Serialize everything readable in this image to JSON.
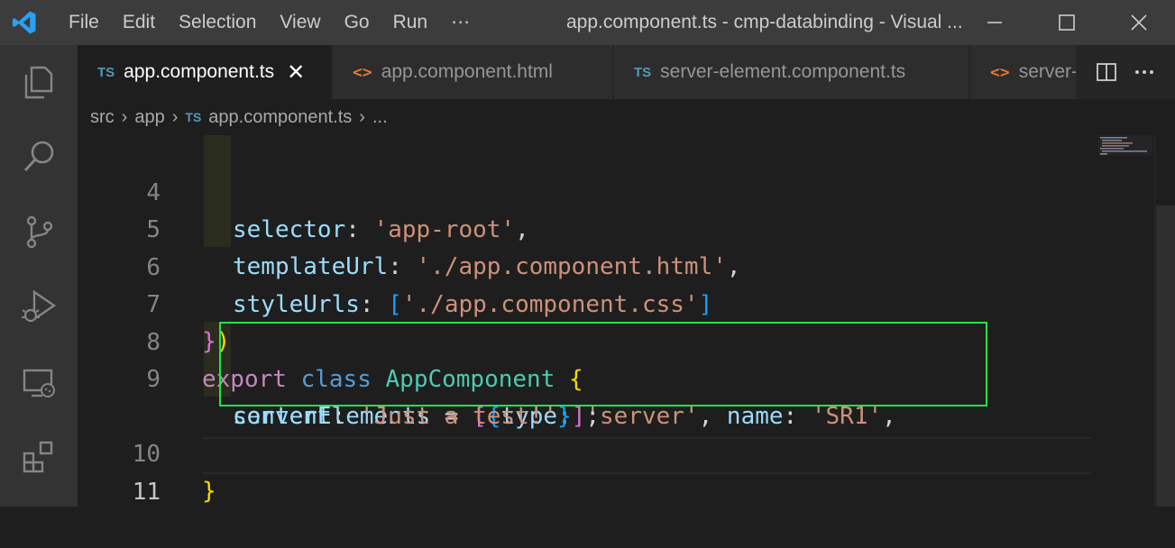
{
  "menu": [
    "File",
    "Edit",
    "Selection",
    "View",
    "Go",
    "Run",
    "⋯"
  ],
  "window_title": "app.component.ts - cmp-databinding - Visual ...",
  "tabs": [
    {
      "icon": "TS",
      "label": "app.component.ts",
      "close": "✕"
    },
    {
      "icon": "<>",
      "label": "app.component.html"
    },
    {
      "icon": "TS",
      "label": "server-element.component.ts"
    },
    {
      "icon": "<>",
      "label": "server-"
    }
  ],
  "breadcrumb": {
    "part1": "src",
    "part2": "app",
    "file_icon": "TS",
    "file": "app.component.ts",
    "more": "..."
  },
  "line_numbers": [
    "4",
    "5",
    "6",
    "7",
    "8",
    "9",
    "10",
    "11"
  ],
  "code": {
    "l4": {
      "prop": "selector",
      "colon": ": ",
      "str": "'app-root'",
      "end": ","
    },
    "l5": {
      "prop": "templateUrl",
      "colon": ": ",
      "str": "'./app.component.html'",
      "end": ","
    },
    "l6": {
      "prop": "styleUrls",
      "colon": ": ",
      "open": "[",
      "str": "'./app.component.css'",
      "close": "]"
    },
    "l7": {
      "brace": "}",
      "paren": ")"
    },
    "l8": {
      "kw1": "export",
      "kw2": "class",
      "cls": "AppComponent",
      "brace": "{"
    },
    "l9a": {
      "prop": "serverElements",
      "eq": " = ",
      "open_sq": "[",
      "open_br": "{",
      "p1": "type",
      "c1": ": ",
      "s1": "'server'",
      "comma1": ", ",
      "p2": "name",
      "c2": ": ",
      "s2": "'SR1'",
      "comma2": ","
    },
    "l9b": {
      "p3": "content",
      "c3": ": ",
      "s3": "'Just a test!'",
      "close_br": "}",
      "close_sq": "]",
      "semi": ";"
    },
    "l10": {
      "brace": "}"
    }
  }
}
